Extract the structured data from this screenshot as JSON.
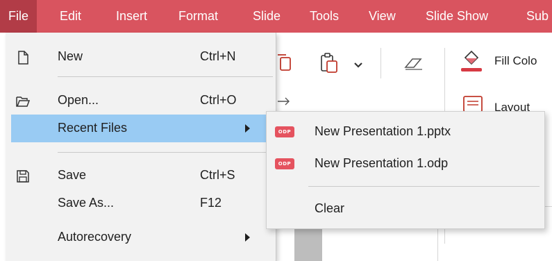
{
  "menubar": {
    "items": [
      "File",
      "Edit",
      "Insert",
      "Format",
      "Slide",
      "Tools",
      "View",
      "Slide Show",
      "Sub"
    ],
    "active": "File",
    "background": "#d9545f",
    "active_background": "#b23c47"
  },
  "toolbar": {
    "fill_color_label": "Fill Colo",
    "layout_label": "Layout",
    "icons": [
      "copy-icon",
      "paste-icon",
      "chevron-down-icon",
      "eraser-icon",
      "fill-bucket-icon",
      "layout-icon",
      "arrow-right-icon"
    ]
  },
  "file_menu": {
    "items": [
      {
        "label": "New",
        "shortcut": "Ctrl+N",
        "icon": "new-document-icon"
      },
      {
        "label": "Open...",
        "shortcut": "Ctrl+O",
        "icon": "folder-open-icon"
      },
      {
        "label": "Recent Files",
        "shortcut": "",
        "icon": "",
        "submenu": true
      },
      {
        "label": "Save",
        "shortcut": "Ctrl+S",
        "icon": "save-icon"
      },
      {
        "label": "Save As...",
        "shortcut": "F12",
        "icon": ""
      },
      {
        "label": "Autorecovery",
        "shortcut": "",
        "icon": "",
        "submenu": true
      }
    ],
    "highlight_color": "#99cbf3"
  },
  "recent_files": {
    "items": [
      {
        "label": "New Presentation 1.pptx",
        "badge": "ODP"
      },
      {
        "label": "New Presentation 1.odp",
        "badge": "ODP"
      }
    ],
    "clear_label": "Clear",
    "badge_color": "#e5535f"
  }
}
